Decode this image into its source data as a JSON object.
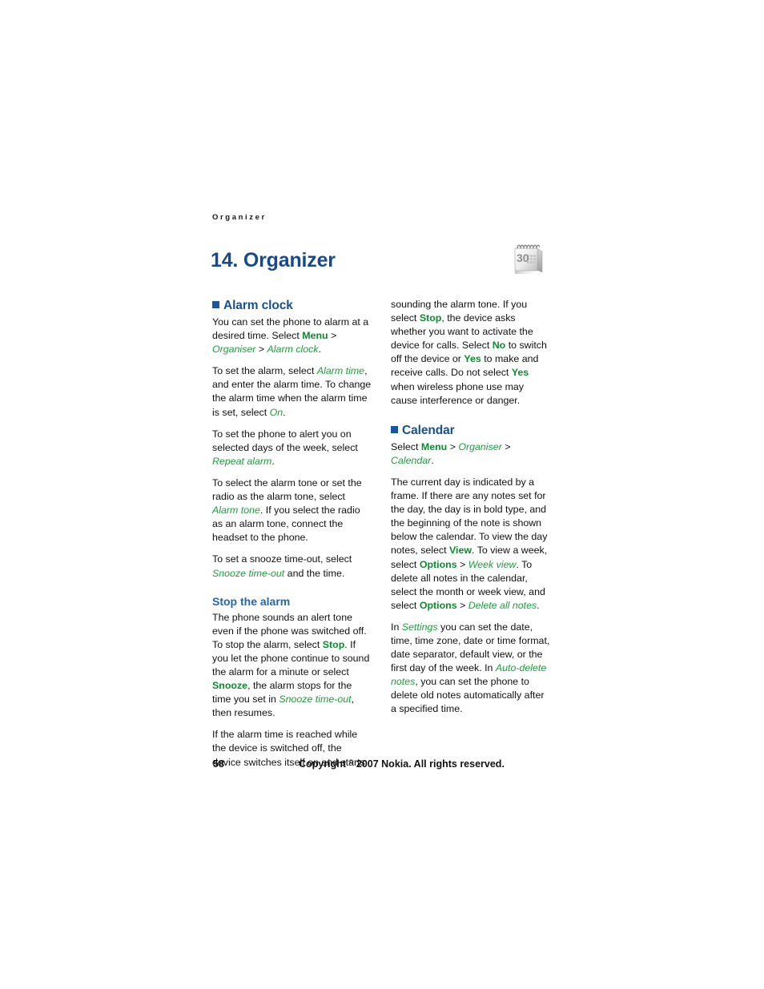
{
  "page": {
    "running_head": "Organizer",
    "chapter_title": "14. Organizer",
    "chapter_icon": "calendar-icon",
    "icon_day_number": "30"
  },
  "colors": {
    "title_blue": "#174a8c",
    "section_blue": "#17508f",
    "bullet_blue": "#1b55a0",
    "subsection_blue": "#2266b4",
    "menu_green_italic": "#1ba03c",
    "key_green_bold": "#0a8c2b",
    "body_text": "#111111",
    "page_background": "#ffffff"
  },
  "left_column": {
    "section_heading": "Alarm clock",
    "paragraphs": [
      {
        "id": "alarm-intro",
        "runs": [
          {
            "t": "You can set the phone to alarm at a desired time. Select ",
            "s": "plain"
          },
          {
            "t": "Menu",
            "s": "key"
          },
          {
            "t": " > ",
            "s": "plain"
          },
          {
            "t": "Organiser",
            "s": "menu"
          },
          {
            "t": " > ",
            "s": "plain"
          },
          {
            "t": "Alarm clock",
            "s": "menu"
          },
          {
            "t": ".",
            "s": "plain"
          }
        ]
      },
      {
        "id": "set-alarm",
        "runs": [
          {
            "t": "To set the alarm, select ",
            "s": "plain"
          },
          {
            "t": "Alarm time",
            "s": "menu"
          },
          {
            "t": ", and enter the alarm time. To change the alarm time when the alarm time is set, select ",
            "s": "plain"
          },
          {
            "t": "On",
            "s": "menu"
          },
          {
            "t": ".",
            "s": "plain"
          }
        ]
      },
      {
        "id": "repeat-alarm",
        "runs": [
          {
            "t": "To set the phone to alert you on selected days of the week, select ",
            "s": "plain"
          },
          {
            "t": "Repeat alarm",
            "s": "menu"
          },
          {
            "t": ".",
            "s": "plain"
          }
        ]
      },
      {
        "id": "alarm-tone",
        "runs": [
          {
            "t": "To select the alarm tone or set the radio as the alarm tone, select ",
            "s": "plain"
          },
          {
            "t": "Alarm tone",
            "s": "menu"
          },
          {
            "t": ". If you select the radio as an alarm tone, connect the headset to the phone.",
            "s": "plain"
          }
        ]
      },
      {
        "id": "snooze-timeout",
        "runs": [
          {
            "t": "To set a snooze time-out, select ",
            "s": "plain"
          },
          {
            "t": "Snooze time-out",
            "s": "menu"
          },
          {
            "t": " and the time.",
            "s": "plain"
          }
        ]
      }
    ],
    "subsection_heading": "Stop the alarm",
    "subsection_paragraphs": [
      {
        "id": "stop-alarm-1",
        "runs": [
          {
            "t": "The phone sounds an alert tone even if the phone was switched off. To stop the alarm, select ",
            "s": "plain"
          },
          {
            "t": "Stop",
            "s": "key"
          },
          {
            "t": ". If you let the phone continue to sound the alarm for a minute or select ",
            "s": "plain"
          },
          {
            "t": "Snooze",
            "s": "key"
          },
          {
            "t": ", the alarm stops for the time you set in ",
            "s": "plain"
          },
          {
            "t": "Snooze time-out",
            "s": "menu"
          },
          {
            "t": ", then resumes.",
            "s": "plain"
          }
        ]
      },
      {
        "id": "stop-alarm-2",
        "runs": [
          {
            "t": "If the alarm time is reached while the device is switched off, the device switches itself on and starts",
            "s": "plain"
          }
        ]
      }
    ]
  },
  "right_column": {
    "continued_paragraph": {
      "id": "stop-alarm-continued",
      "runs": [
        {
          "t": "sounding the alarm tone. If you select ",
          "s": "plain"
        },
        {
          "t": "Stop",
          "s": "key"
        },
        {
          "t": ", the device asks whether you want to activate the device for calls. Select ",
          "s": "plain"
        },
        {
          "t": "No",
          "s": "key"
        },
        {
          "t": " to switch off the device or ",
          "s": "plain"
        },
        {
          "t": "Yes",
          "s": "key"
        },
        {
          "t": " to make and receive calls. Do not select ",
          "s": "plain"
        },
        {
          "t": "Yes",
          "s": "key"
        },
        {
          "t": " when wireless phone use may cause interference or danger.",
          "s": "plain"
        }
      ]
    },
    "section_heading": "Calendar",
    "paragraphs": [
      {
        "id": "calendar-path",
        "runs": [
          {
            "t": "Select ",
            "s": "plain"
          },
          {
            "t": "Menu",
            "s": "key"
          },
          {
            "t": " > ",
            "s": "plain"
          },
          {
            "t": "Organiser",
            "s": "menu"
          },
          {
            "t": " > ",
            "s": "plain"
          },
          {
            "t": "Calendar",
            "s": "menu"
          },
          {
            "t": ".",
            "s": "plain"
          }
        ]
      },
      {
        "id": "calendar-desc",
        "runs": [
          {
            "t": "The current day is indicated by a frame. If there are any notes set for the day, the day is in bold type, and the beginning of the note is shown below the calendar. To view the day notes, select ",
            "s": "plain"
          },
          {
            "t": "View",
            "s": "key"
          },
          {
            "t": ". To view a week, select ",
            "s": "plain"
          },
          {
            "t": "Options",
            "s": "key"
          },
          {
            "t": " > ",
            "s": "plain"
          },
          {
            "t": "Week view",
            "s": "menu"
          },
          {
            "t": ". To delete all notes in the calendar, select the month or week view, and select ",
            "s": "plain"
          },
          {
            "t": "Options",
            "s": "key"
          },
          {
            "t": " > ",
            "s": "plain"
          },
          {
            "t": "Delete all notes",
            "s": "menu"
          },
          {
            "t": ".",
            "s": "plain"
          }
        ]
      },
      {
        "id": "calendar-settings",
        "runs": [
          {
            "t": "In ",
            "s": "plain"
          },
          {
            "t": "Settings",
            "s": "menu"
          },
          {
            "t": " you can set the date, time, time zone, date or time format, date separator, default view, or the first day of the week. In ",
            "s": "plain"
          },
          {
            "t": "Auto-delete notes",
            "s": "menu"
          },
          {
            "t": ", you can set the phone to delete old notes automatically after a specified time.",
            "s": "plain"
          }
        ]
      }
    ]
  },
  "footer": {
    "page_number": "58",
    "copyright_prefix": "Copyright ",
    "copyright_symbol": "©",
    "copyright_suffix": " 2007 Nokia. All rights reserved."
  }
}
